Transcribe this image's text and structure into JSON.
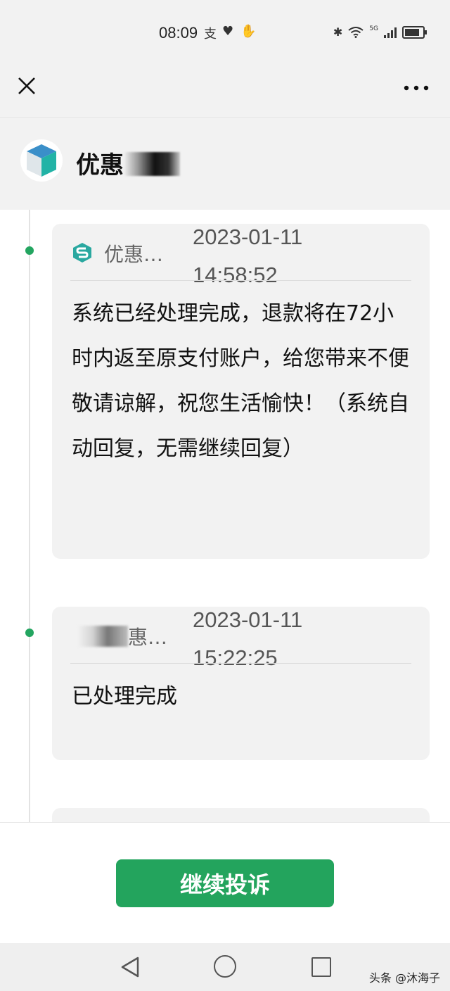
{
  "status_bar": {
    "time": "08:09",
    "left_glyphs": [
      "支",
      "♥",
      "✋"
    ],
    "network": "5G"
  },
  "navbar": {
    "close_icon": "close-icon",
    "more_label": "•••"
  },
  "merchant": {
    "name_visible": "优惠",
    "logo_icon": "cube-logo-icon"
  },
  "messages": [
    {
      "sender": "优惠…",
      "time_date": "2023-01-11",
      "time_clock": "14:58:52",
      "body": "系统已经处理完成，退款将在72小时内返至原支付账户，给您带来不便敬请谅解，祝您生活愉快！（系统自动回复，无需继续回复）"
    },
    {
      "sender": "惠…",
      "time_date": "2023-01-11",
      "time_clock": "15:22:25",
      "body": "已处理完成"
    }
  ],
  "action": {
    "continue_label": "继续投诉"
  },
  "watermark": "头条 @沐海子",
  "colors": {
    "accent_green": "#23a45d",
    "timeline_dot": "#23a560",
    "card_bg": "#f2f2f2"
  }
}
